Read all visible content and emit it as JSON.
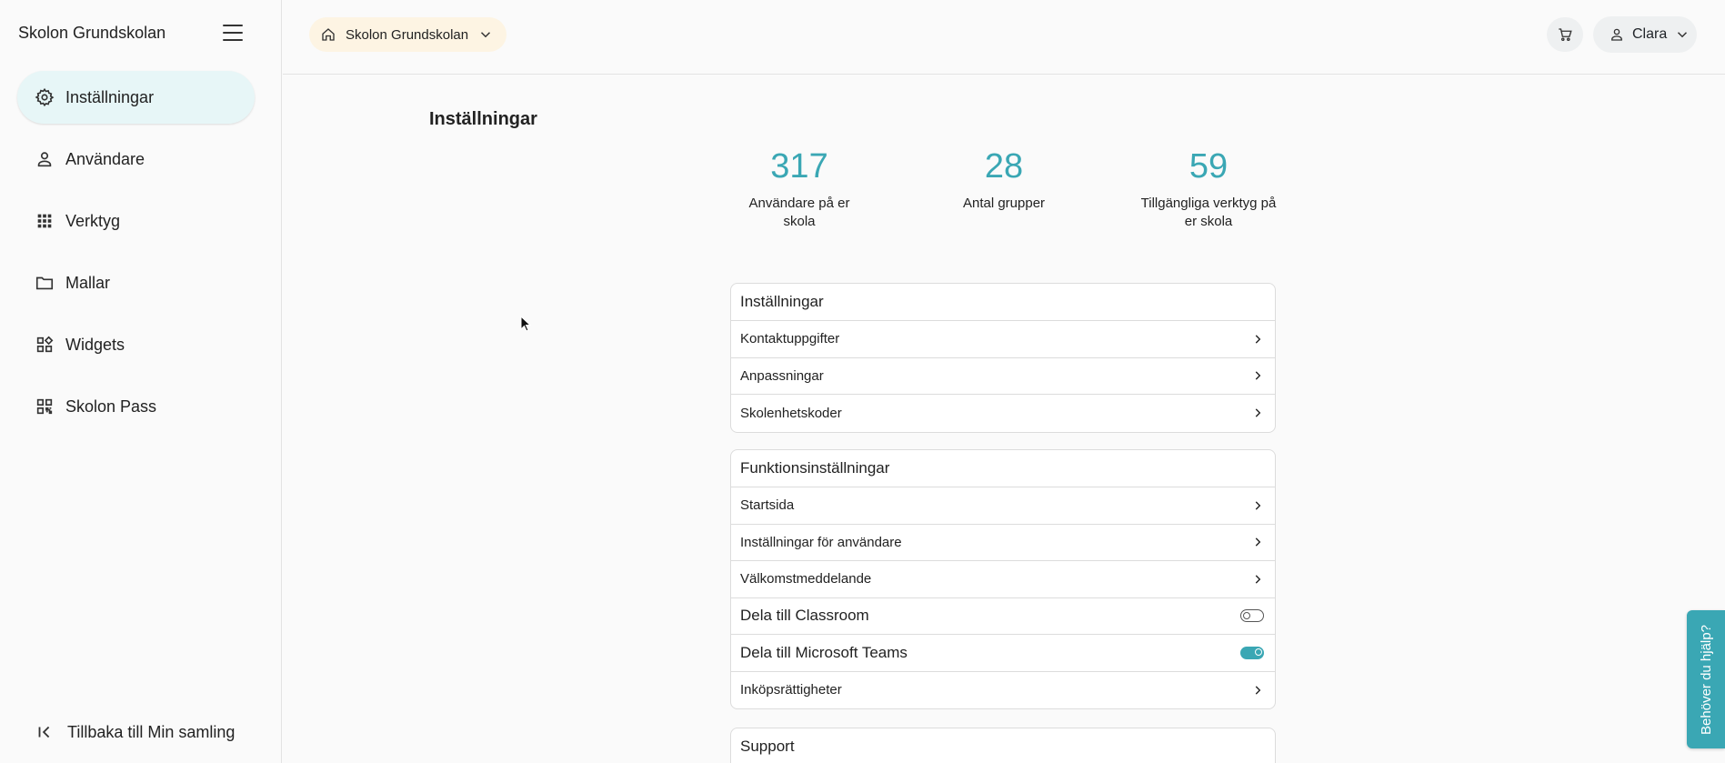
{
  "sidebar": {
    "title": "Skolon Grundskolan",
    "items": [
      {
        "label": "Inställningar",
        "icon": "gear-icon",
        "active": true
      },
      {
        "label": "Användare",
        "icon": "person-icon"
      },
      {
        "label": "Verktyg",
        "icon": "apps-grid-icon"
      },
      {
        "label": "Mallar",
        "icon": "folder-icon"
      },
      {
        "label": "Widgets",
        "icon": "widgets-icon"
      },
      {
        "label": "Skolon Pass",
        "icon": "qr-code-icon"
      }
    ],
    "footer_label": "Tillbaka till Min samling"
  },
  "topbar": {
    "school": "Skolon Grundskolan",
    "user": "Clara"
  },
  "main": {
    "title": "Inställningar",
    "stats": [
      {
        "value": "317",
        "label": "Användare på er skola"
      },
      {
        "value": "28",
        "label": "Antal grupper"
      },
      {
        "value": "59",
        "label": "Tillgängliga verktyg på er skola"
      }
    ],
    "settings_card": {
      "title": "Inställningar",
      "rows": [
        "Kontaktuppgifter",
        "Anpassningar",
        "Skolenhetskoder"
      ]
    },
    "function_card": {
      "title": "Funktionsinställningar",
      "rows": [
        "Startsida",
        "Inställningar för användare",
        "Välkomstmeddelande"
      ],
      "toggles": [
        {
          "label": "Dela till Classroom",
          "on": false
        },
        {
          "label": "Dela till Microsoft Teams",
          "on": true
        }
      ],
      "last_row": "Inköpsrättigheter"
    },
    "support_card": {
      "title": "Support"
    }
  },
  "help_tab": "Behöver du hjälp?",
  "colors": {
    "accent": "#3aa7b4",
    "active_nav": "#e7f6f7",
    "school_chip": "#fdf4e3"
  }
}
